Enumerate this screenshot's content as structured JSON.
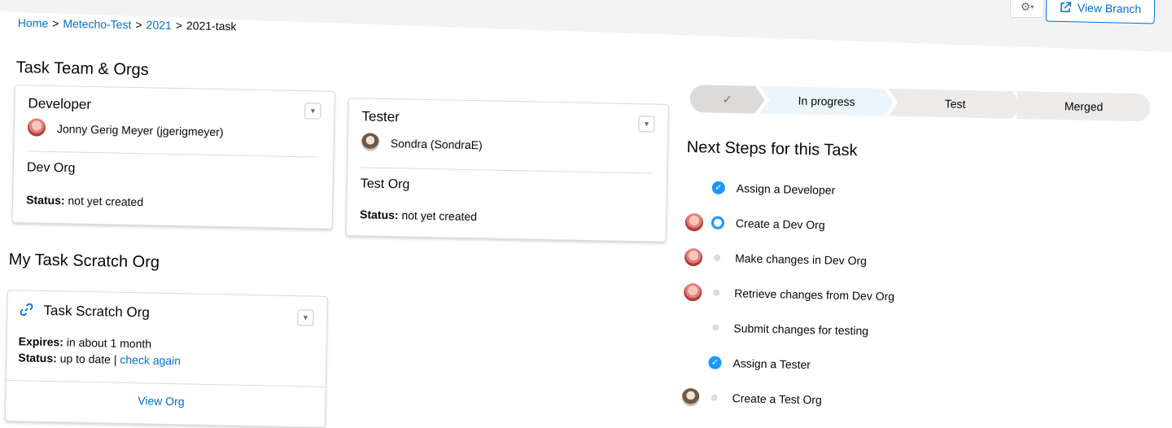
{
  "breadcrumb": [
    {
      "label": "Home",
      "link": true
    },
    {
      "label": "Metecho-Test",
      "link": true
    },
    {
      "label": "2021",
      "link": true
    },
    {
      "label": "2021-task",
      "link": false
    }
  ],
  "breadcrumb_sep": ">",
  "header": {
    "settings_icon": "gear-icon",
    "view_branch_label": "View Branch",
    "view_branch_icon": "external-link-icon"
  },
  "team": {
    "title": "Task Team & Orgs",
    "developer": {
      "title": "Developer",
      "user": "Jonny Gerig Meyer (jgerigmeyer)",
      "org": "Dev Org",
      "status_label": "Status:",
      "status_value": "not yet created"
    },
    "tester": {
      "title": "Tester",
      "user": "Sondra (SondraE)",
      "org": "Test Org",
      "status_label": "Status:",
      "status_value": "not yet created"
    }
  },
  "scratch": {
    "title": "My Task Scratch Org",
    "card_title": "Task Scratch Org",
    "expires_label": "Expires:",
    "expires_value": "in about 1 month",
    "status_label": "Status:",
    "status_value": "up to date |",
    "check_again": "check again",
    "view_org": "View Org"
  },
  "path": {
    "stages": [
      {
        "label": "✓",
        "state": "complete",
        "color": "#dddbda"
      },
      {
        "label": "In progress",
        "state": "current",
        "color": "#eaf5fe"
      },
      {
        "label": "Test",
        "state": "incomplete",
        "color": "#ecebea"
      },
      {
        "label": "Merged",
        "state": "incomplete",
        "color": "#ecebea"
      }
    ]
  },
  "next_steps": {
    "title": "Next Steps for this Task",
    "items": [
      {
        "label": "Assign a Developer",
        "state": "done",
        "avatar": "none"
      },
      {
        "label": "Create a Dev Org",
        "state": "active",
        "avatar": "developer"
      },
      {
        "label": "Make changes in Dev Org",
        "state": "pending",
        "avatar": "developer"
      },
      {
        "label": "Retrieve changes from Dev Org",
        "state": "pending",
        "avatar": "developer"
      },
      {
        "label": "Submit changes for testing",
        "state": "pending",
        "avatar": "none"
      },
      {
        "label": "Assign a Tester",
        "state": "done",
        "avatar": "none"
      },
      {
        "label": "Create a Test Org",
        "state": "pending",
        "avatar": "tester"
      }
    ]
  },
  "colors": {
    "link": "#0070d2",
    "done": "#1b96ff",
    "pending": "#d8dde6"
  }
}
